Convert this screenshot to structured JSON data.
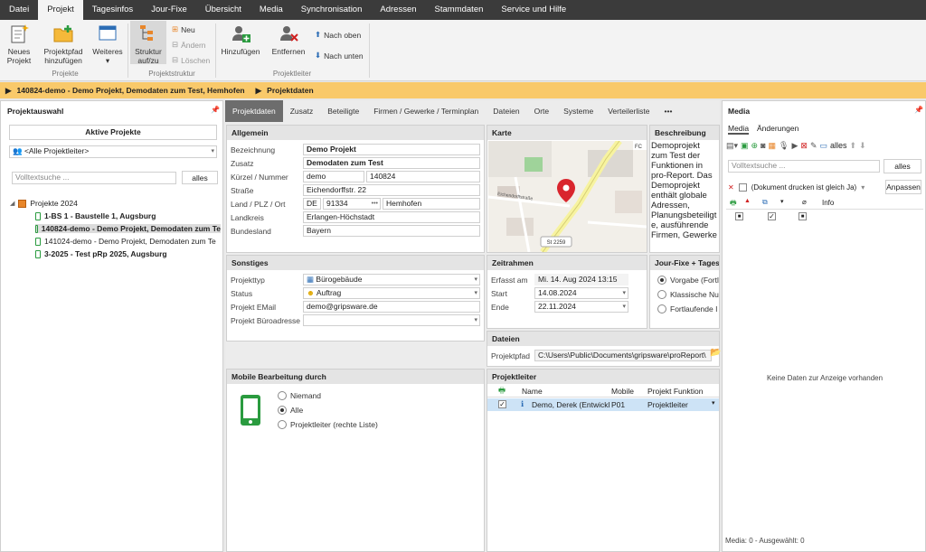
{
  "menu": [
    "Datei",
    "Projekt",
    "Tagesinfos",
    "Jour-Fixe",
    "Übersicht",
    "Media",
    "Synchronisation",
    "Adressen",
    "Stammdaten",
    "Service und Hilfe"
  ],
  "ribbon": {
    "new_project": [
      "Neues",
      "Projekt"
    ],
    "add_path": [
      "Projektpfad",
      "hinzufügen"
    ],
    "more": "Weiteres",
    "group_projects": "Projekte",
    "structure": [
      "Struktur",
      "auf/zu"
    ],
    "neu": "Neu",
    "aendern": "Ändern",
    "loeschen": "Löschen",
    "group_structure": "Projektstruktur",
    "add": "Hinzufügen",
    "remove": "Entfernen",
    "up": "Nach oben",
    "down": "Nach unten",
    "group_leader": "Projektleiter"
  },
  "breadcrumb": {
    "project": "140824-demo - Demo Projekt, Demodaten zum Test, Hemhofen",
    "current": "Projektdaten"
  },
  "left": {
    "title": "Projektauswahl",
    "active_btn": "Aktive Projekte",
    "leader_select": "<Alle Projektleiter>",
    "search_placeholder": "Volltextsuche ...",
    "all_btn": "alles",
    "tree_root": "Projekte 2024",
    "items": [
      {
        "label": "1-BS 1  - Baustelle 1, Augsburg",
        "bold": true
      },
      {
        "label": "140824-demo - Demo Projekt, Demodaten zum Te",
        "bold": true
      },
      {
        "label": "141024-demo - Demo Projekt, Demodaten zum Te",
        "bold": false
      },
      {
        "label": "3-2025 - Test pRp 2025, Augsburg",
        "bold": true
      }
    ]
  },
  "tabs": [
    "Projektdaten",
    "Zusatz",
    "Beteiligte",
    "Firmen / Gewerke / Terminplan",
    "Dateien",
    "Orte",
    "Systeme",
    "Verteilerliste",
    "•••"
  ],
  "allgemein": {
    "title": "Allgemein",
    "labels": [
      "Bezeichnung",
      "Zusatz",
      "Kürzel / Nummer",
      "Straße",
      "Land / PLZ / Ort",
      "Landkreis",
      "Bundesland"
    ],
    "bezeichnung": "Demo Projekt",
    "zusatz": "Demodaten zum Test",
    "kuerzel": "demo",
    "nummer": "140824",
    "strasse": "Eichendorffstr. 22",
    "land": "DE",
    "plz": "91334",
    "ort": "Hemhofen",
    "landkreis": "Erlangen-Höchstadt",
    "bundesland": "Bayern"
  },
  "karte": {
    "title": "Karte",
    "street": "Eichendorffstraße",
    "road": "St 2259",
    "corner": "FC"
  },
  "beschreibung": {
    "title": "Beschreibung",
    "text": "Demoprojekt zum Test der Funktionen in pro-Report. Das Demoprojekt enthält globale Adressen, Planungsbeteiligte, ausführende Firmen, Gewerke"
  },
  "sonstiges": {
    "title": "Sonstiges",
    "labels": [
      "Projekttyp",
      "Status",
      "Projekt EMail",
      "Projekt Büroadresse"
    ],
    "typ": "Bürogebäude",
    "status": "Auftrag",
    "email": "demo@gripsware.de",
    "buero": ""
  },
  "zeitrahmen": {
    "title": "Zeitrahmen",
    "labels": [
      "Erfasst am",
      "Start",
      "Ende"
    ],
    "erfasst": "Mi. 14. Aug 2024  13:15",
    "start": "14.08.2024",
    "ende": "22.11.2024"
  },
  "jourfixe": {
    "title": "Jour-Fixe + Tagesinf",
    "options": [
      "Vorgabe (Fortl",
      "Klassische Nu",
      "Fortlaufende I"
    ],
    "selected": 0
  },
  "dateien": {
    "title": "Dateien",
    "label": "Projektpfad",
    "path": "C:\\Users\\Public\\Documents\\gripsware\\proReport\\"
  },
  "mobile": {
    "title": "Mobile Bearbeitung durch",
    "options": [
      "Niemand",
      "Alle",
      "Projektleiter (rechte Liste)"
    ],
    "selected": 1
  },
  "projektleiter": {
    "title": "Projektleiter",
    "cols": [
      "Name",
      "Mobile",
      "Projekt Funktion"
    ],
    "row": {
      "name": "Demo, Derek (Entwickl",
      "mobile": "P01",
      "funktion": "Projektleiter"
    }
  },
  "media": {
    "title": "Media",
    "tabs": [
      "Media",
      "Änderungen"
    ],
    "all_btn": "alles",
    "search_placeholder": "Volltextsuche ...",
    "all_btn2": "alles",
    "filter": "(Dokument drucken ist gleich Ja)",
    "anpassen": "Anpassen",
    "col_info": "Info",
    "empty": "Keine Daten zur Anzeige vorhanden",
    "status": "Media: 0  -  Ausgewählt: 0"
  },
  "colors": {
    "accent": "#f9c96a",
    "menubar": "#3b3b3b",
    "green": "#2a9b3f",
    "orange": "#e8862a"
  }
}
